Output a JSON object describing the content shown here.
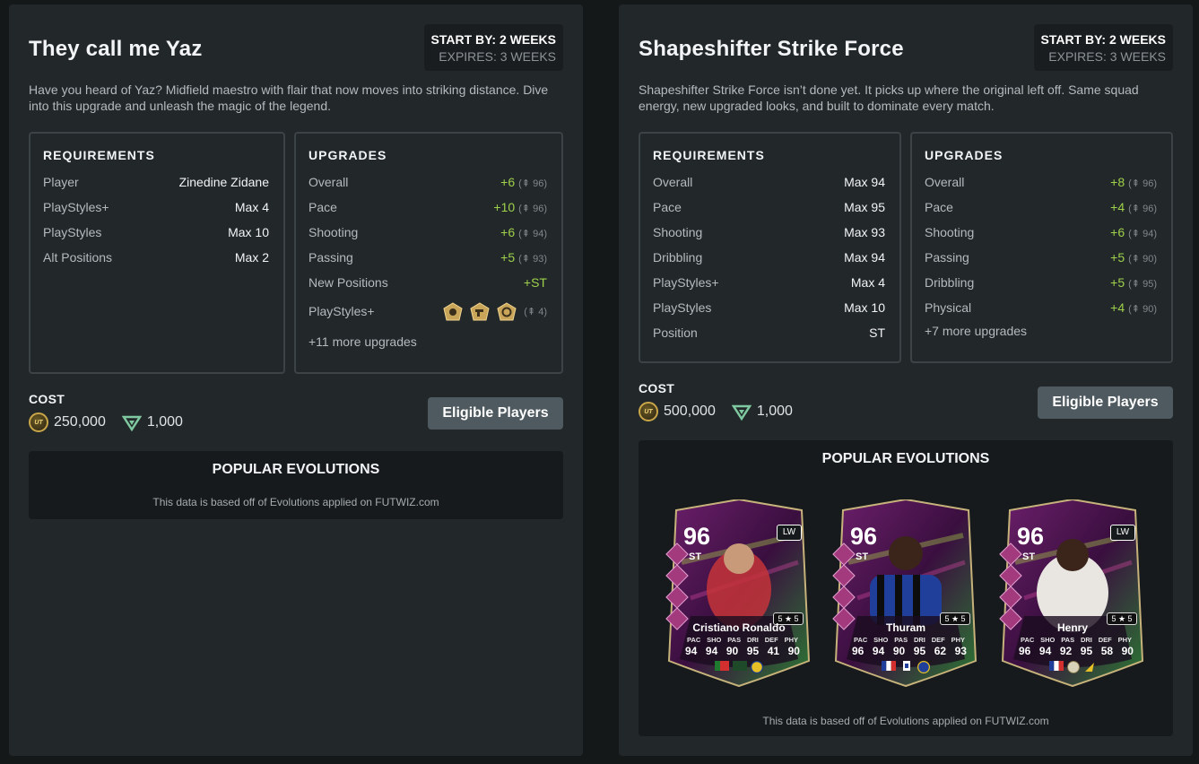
{
  "evolutions": [
    {
      "title": "They call me Yaz",
      "start_by": "START BY: 2 WEEKS",
      "expires": "EXPIRES: 3 WEEKS",
      "description": "Have you heard of Yaz? Midfield maestro with flair that now moves into striking distance. Dive into this upgrade and unleash the magic of the legend.",
      "requirements_title": "REQUIREMENTS",
      "requirements": [
        {
          "label": "Player",
          "value": "Zinedine Zidane"
        },
        {
          "label": "PlayStyles+",
          "value": "Max 4"
        },
        {
          "label": "PlayStyles",
          "value": "Max 10"
        },
        {
          "label": "Alt Positions",
          "value": "Max 2"
        }
      ],
      "upgrades_title": "UPGRADES",
      "upgrades": [
        {
          "label": "Overall",
          "value": "+6",
          "cap": "96"
        },
        {
          "label": "Pace",
          "value": "+10",
          "cap": "96"
        },
        {
          "label": "Shooting",
          "value": "+6",
          "cap": "94"
        },
        {
          "label": "Passing",
          "value": "+5",
          "cap": "93"
        },
        {
          "label": "New Positions",
          "value": "+ST",
          "cap": ""
        }
      ],
      "playstyles_label": "PlayStyles+",
      "playstyles_cap": "4",
      "playstyles_icons": [
        "finesse-shot-icon",
        "power-shot-icon",
        "tiki-taka-icon"
      ],
      "more_upgrades": "+11 more upgrades",
      "cost_label": "COST",
      "coins": "250,000",
      "points": "1,000",
      "eligible_label": "Eligible Players",
      "popular_title": "POPULAR EVOLUTIONS",
      "popular_note": "This data is based off of Evolutions applied on FUTWIZ.com"
    },
    {
      "title": "Shapeshifter Strike Force",
      "start_by": "START BY: 2 WEEKS",
      "expires": "EXPIRES: 3 WEEKS",
      "description": "Shapeshifter Strike Force isn’t done yet. It picks up where the original left off. Same squad energy, new upgraded looks, and built to dominate every match.",
      "requirements_title": "REQUIREMENTS",
      "requirements": [
        {
          "label": "Overall",
          "value": "Max 94"
        },
        {
          "label": "Pace",
          "value": "Max 95"
        },
        {
          "label": "Shooting",
          "value": "Max 93"
        },
        {
          "label": "Dribbling",
          "value": "Max 94"
        },
        {
          "label": "PlayStyles+",
          "value": "Max 4"
        },
        {
          "label": "PlayStyles",
          "value": "Max 10"
        },
        {
          "label": "Position",
          "value": "ST"
        }
      ],
      "upgrades_title": "UPGRADES",
      "upgrades": [
        {
          "label": "Overall",
          "value": "+8",
          "cap": "96"
        },
        {
          "label": "Pace",
          "value": "+4",
          "cap": "96"
        },
        {
          "label": "Shooting",
          "value": "+6",
          "cap": "94"
        },
        {
          "label": "Passing",
          "value": "+5",
          "cap": "90"
        },
        {
          "label": "Dribbling",
          "value": "+5",
          "cap": "95"
        },
        {
          "label": "Physical",
          "value": "+4",
          "cap": "90"
        }
      ],
      "more_upgrades": "+7 more upgrades",
      "cost_label": "COST",
      "coins": "500,000",
      "points": "1,000",
      "eligible_label": "Eligible Players",
      "popular_title": "POPULAR EVOLUTIONS",
      "popular_note": "This data is based off of Evolutions applied on FUTWIZ.com",
      "cards": [
        {
          "name": "Cristiano Ronaldo",
          "rating": "96",
          "position": "ST",
          "alt_position": "LW",
          "skills": "5 ★ 5",
          "stat_labels": [
            "PAC",
            "SHO",
            "PAS",
            "DRI",
            "DEF",
            "PHY"
          ],
          "stats": [
            "94",
            "94",
            "90",
            "95",
            "41",
            "90"
          ]
        },
        {
          "name": "Thuram",
          "rating": "96",
          "position": "ST",
          "alt_position": "",
          "skills": "5 ★ 5",
          "stat_labels": [
            "PAC",
            "SHO",
            "PAS",
            "DRI",
            "DEF",
            "PHY"
          ],
          "stats": [
            "96",
            "94",
            "90",
            "95",
            "62",
            "93"
          ]
        },
        {
          "name": "Henry",
          "rating": "96",
          "position": "ST",
          "alt_position": "LW",
          "skills": "5 ★ 5",
          "stat_labels": [
            "PAC",
            "SHO",
            "PAS",
            "DRI",
            "DEF",
            "PHY"
          ],
          "stats": [
            "96",
            "94",
            "92",
            "95",
            "58",
            "90"
          ]
        }
      ]
    }
  ],
  "coin_badge": "UT",
  "colors": {
    "upgrade_green": "#9fd14a",
    "panel": "#22272a",
    "button": "#4e5a5f",
    "card_purple": "#5a1b58",
    "card_green": "#3f8f3a"
  }
}
